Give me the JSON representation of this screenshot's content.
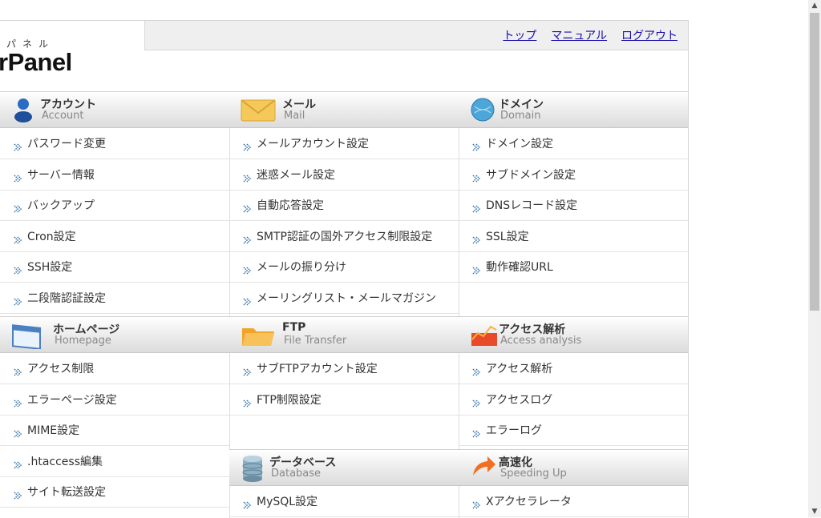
{
  "header": {
    "logo_sub": "パネル",
    "logo_main": "rPanel",
    "links": [
      "トップ",
      "マニュアル",
      "ログアウト"
    ]
  },
  "sections": [
    {
      "jp": "アカウント",
      "en": "Account",
      "icon": "account-person-icon",
      "items": [
        "パスワード変更",
        "サーバー情報",
        "バックアップ",
        "Cron設定",
        "SSH設定",
        "二段階認証設定"
      ]
    },
    {
      "jp": "メール",
      "en": "Mail",
      "icon": "mail-envelope-icon",
      "items": [
        "メールアカウント設定",
        "迷惑メール設定",
        "自動応答設定",
        "SMTP認証の国外アクセス制限設定",
        "メールの振り分け",
        "メーリングリスト・メールマガジン"
      ]
    },
    {
      "jp": "ドメイン",
      "en": "Domain",
      "icon": "domain-globe-icon",
      "items": [
        "ドメイン設定",
        "サブドメイン設定",
        "DNSレコード設定",
        "SSL設定",
        "動作確認URL"
      ]
    },
    {
      "jp": "ホームページ",
      "en": "Homepage",
      "icon": "homepage-window-icon",
      "items": [
        "アクセス制限",
        "エラーページ設定",
        "MIME設定",
        ".htaccess編集",
        "サイト転送設定"
      ]
    },
    {
      "jp": "FTP",
      "en": "File Transfer",
      "icon": "ftp-folder-icon",
      "items": [
        "サブFTPアカウント設定",
        "FTP制限設定"
      ]
    },
    {
      "jp": "アクセス解析",
      "en": "Access analysis",
      "icon": "access-analysis-chart-icon",
      "items": [
        "アクセス解析",
        "アクセスログ",
        "エラーログ"
      ]
    },
    {
      "jp": "データベース",
      "en": "Database",
      "icon": "database-cylinder-icon",
      "items": [
        "MySQL設定"
      ]
    },
    {
      "jp": "高速化",
      "en": "Speeding Up",
      "icon": "speed-up-arrow-icon",
      "items": [
        "Xアクセラレータ"
      ]
    }
  ],
  "colors": {
    "link": "#1a0dab",
    "arrow": "#2f6fa8",
    "header_bg": "#efefef"
  }
}
